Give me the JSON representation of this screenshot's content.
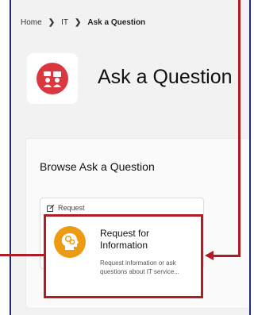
{
  "breadcrumb": {
    "home": "Home",
    "it": "IT",
    "current": "Ask a Question"
  },
  "page": {
    "title": "Ask a Question",
    "icon": "ask-question-icon"
  },
  "panel": {
    "title": "Browse Ask a Question",
    "background_card_label": "Request"
  },
  "card": {
    "title": "Request for Information",
    "description": "Request information or ask questions about IT service...",
    "icon": "head-gears-icon"
  },
  "colors": {
    "highlight": "#b01c25",
    "hero_icon_bg": "#d9383f",
    "card_icon_bg": "#ee9b14",
    "frame_border": "#1d2f6b"
  }
}
